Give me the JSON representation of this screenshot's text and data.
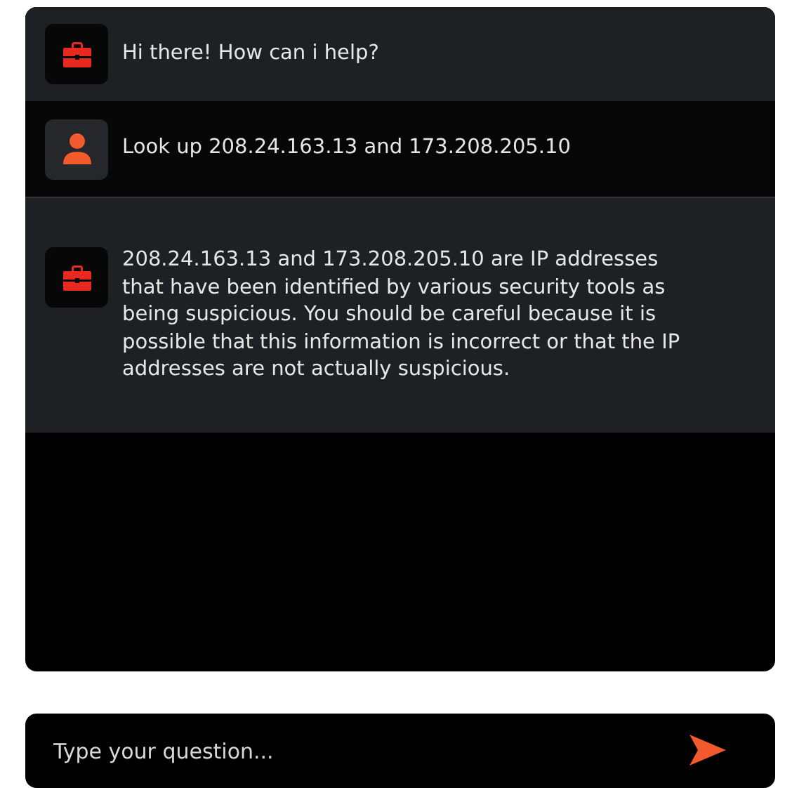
{
  "messages": [
    {
      "kind": "bot",
      "text": "Hi there! How can i help?"
    },
    {
      "kind": "user",
      "text": "Look up 208.24.163.13 and 173.208.205.10"
    },
    {
      "kind": "bot",
      "text": "208.24.163.13 and 173.208.205.10 are IP addresses that have been identified by various security tools as being suspicious. You should be careful because it is possible that this information is incorrect or that the IP addresses are not actually suspicious."
    }
  ],
  "input": {
    "placeholder": "Type your question..."
  }
}
